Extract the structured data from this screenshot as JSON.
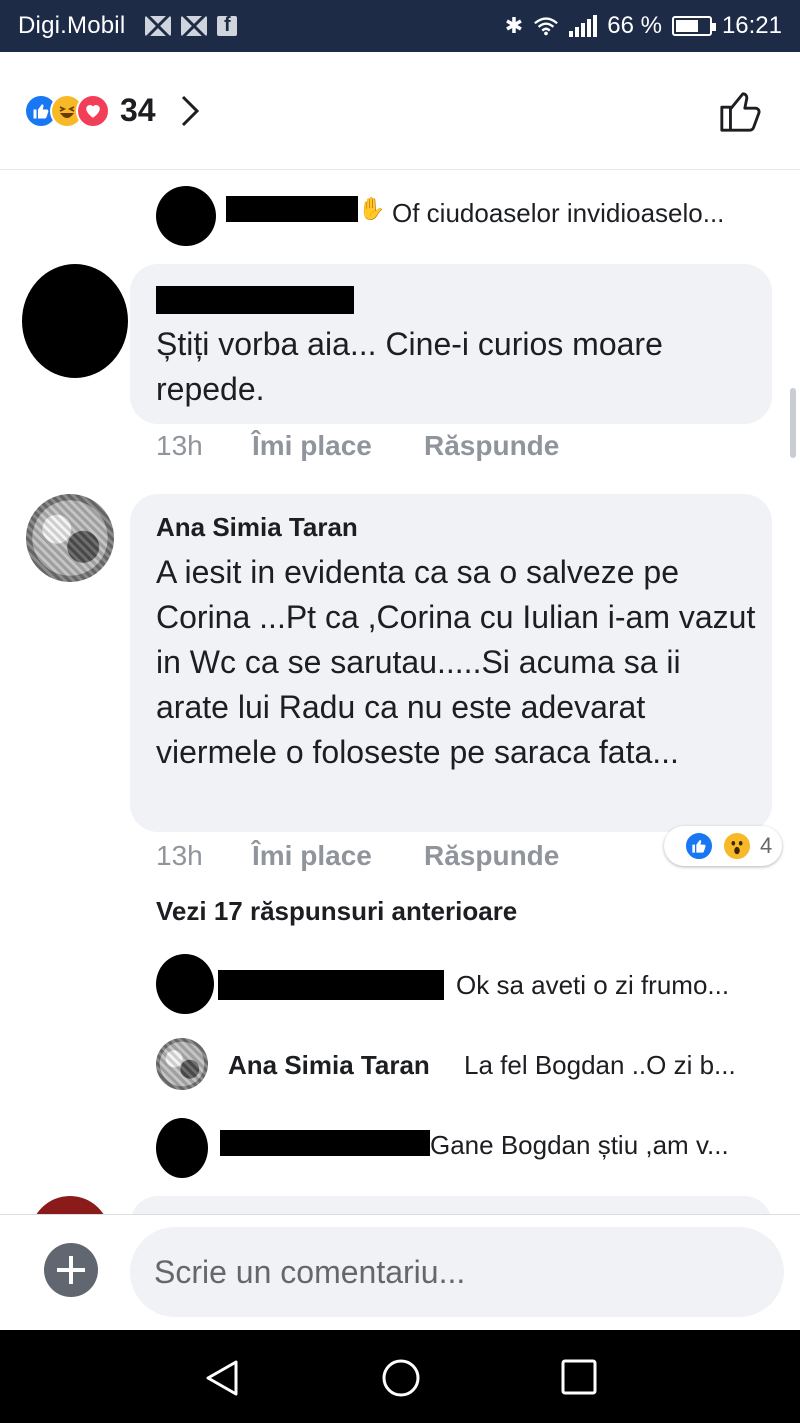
{
  "status_bar": {
    "carrier": "Digi.Mobil",
    "battery": "66 %",
    "time": "16:21"
  },
  "reactions": {
    "count": "34",
    "types": [
      "like-icon",
      "haha-icon",
      "love-icon"
    ]
  },
  "comments": [
    {
      "reply_preview": "Of ciudoaselor invidioaselo..."
    },
    {
      "text": "Știți vorba aia... Cine-i curios moare repede.",
      "time": "13h",
      "like_label": "Îmi place",
      "reply_label": "Răspunde"
    },
    {
      "author": "Ana Simia Taran",
      "text": "A iesit in evidenta ca sa o salveze pe Corina ...Pt ca ,Corina cu Iulian i-am vazut in Wc ca se sarutau.....Si acuma sa ii arate lui Radu ca nu este adevarat viermele o foloseste pe saraca fata...",
      "time": "13h",
      "like_label": "Îmi place",
      "reply_label": "Răspunde",
      "reaction_count": "4",
      "view_replies": "Vezi 17 răspunsuri anterioare",
      "replies": [
        {
          "text": "Ok sa aveti o zi frumo..."
        },
        {
          "author": "Ana Simia Taran",
          "text": "La fel Bogdan ..O zi b..."
        },
        {
          "text": "Gane Bogdan știu ,am v..."
        }
      ]
    }
  ],
  "composer": {
    "placeholder": "Scrie un comentariu..."
  },
  "colors": {
    "status_bar": "#1d2b47",
    "like_blue": "#1877f2",
    "bubble": "#f0f2f5",
    "meta_gray": "#90949c"
  }
}
